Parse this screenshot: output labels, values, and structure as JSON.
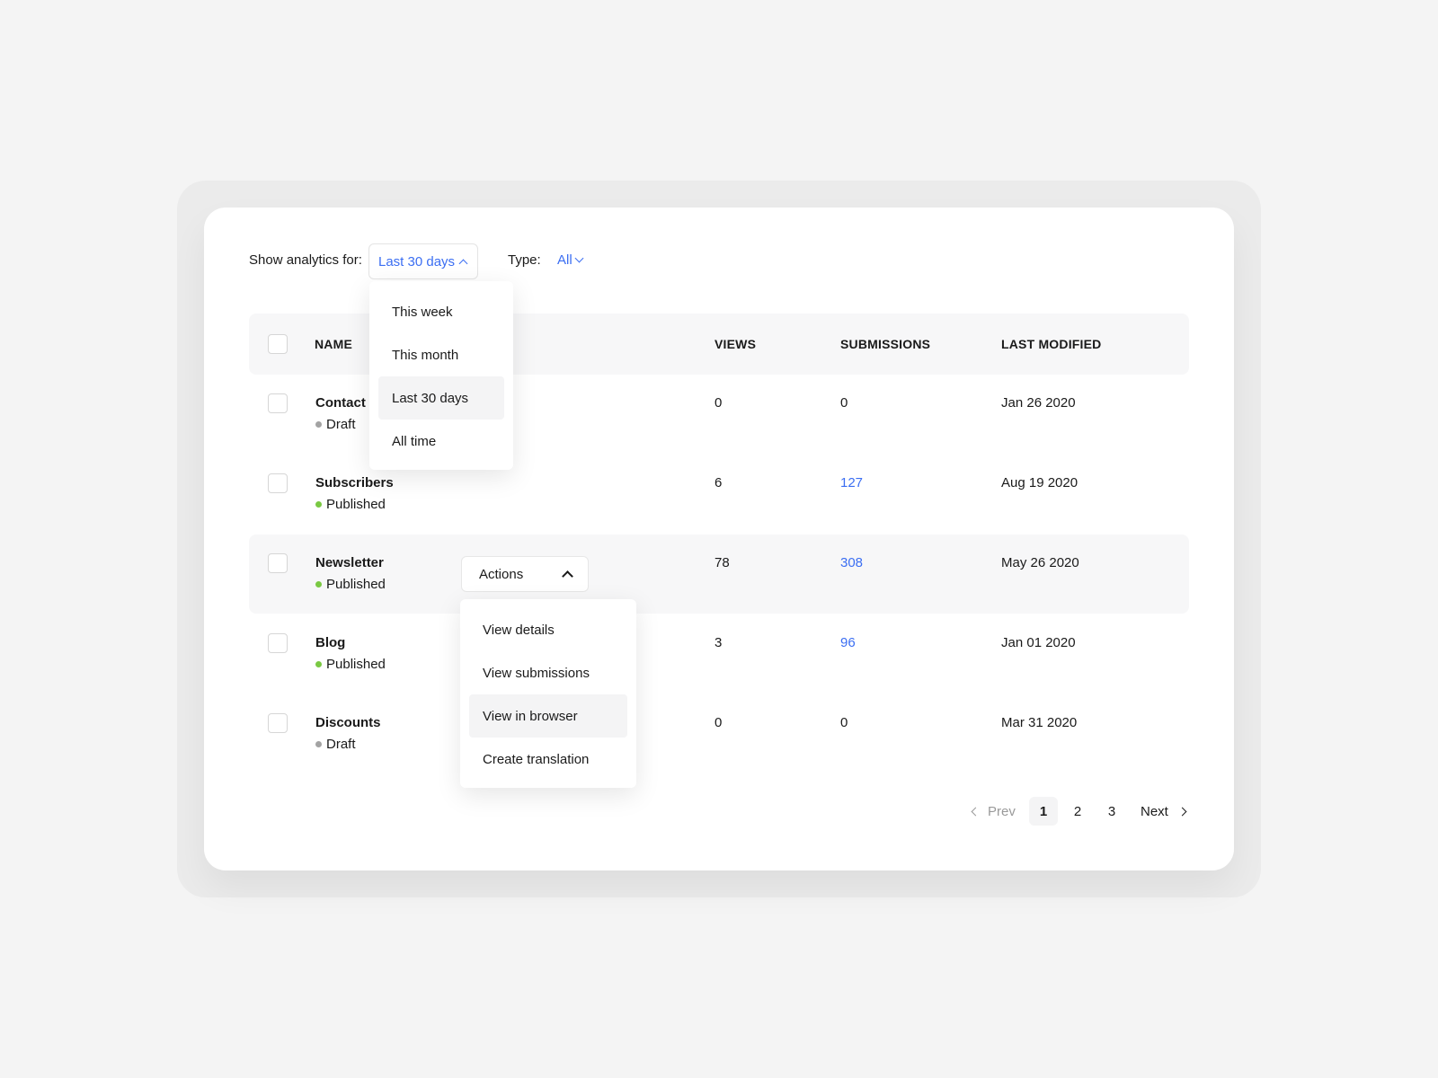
{
  "filters": {
    "show_label": "Show analytics for:",
    "period_selected": "Last 30 days",
    "type_label": "Type:",
    "type_selected": "All"
  },
  "period_menu": [
    "This week",
    "This month",
    "Last 30 days",
    "All time"
  ],
  "table": {
    "columns": [
      "NAME",
      "VIEWS",
      "SUBMISSIONS",
      "LAST MODIFIED"
    ],
    "rows": [
      {
        "name": "Contact",
        "status": "Draft",
        "views": "0",
        "submissions": "0",
        "modified": "Jan 26 2020"
      },
      {
        "name": "Subscribers",
        "status": "Published",
        "views": "6",
        "submissions": "127",
        "modified": "Aug 19 2020"
      },
      {
        "name": "Newsletter",
        "status": "Published",
        "views": "78",
        "submissions": "308",
        "modified": "May 26 2020"
      },
      {
        "name": "Blog",
        "status": "Published",
        "views": "3",
        "submissions": "96",
        "modified": "Jan 01 2020"
      },
      {
        "name": "Discounts",
        "status": "Draft",
        "views": "0",
        "submissions": "0",
        "modified": "Mar 31 2020"
      }
    ]
  },
  "actions": {
    "label": "Actions",
    "menu": [
      "View details",
      "View submissions",
      "View in browser",
      "Create translation"
    ]
  },
  "pagination": {
    "prev": "Prev",
    "pages": [
      "1",
      "2",
      "3"
    ],
    "current": "1",
    "next": "Next"
  },
  "colors": {
    "accent": "#3b6ef2",
    "draft": "#a3a3a3",
    "published": "#7ac943"
  }
}
